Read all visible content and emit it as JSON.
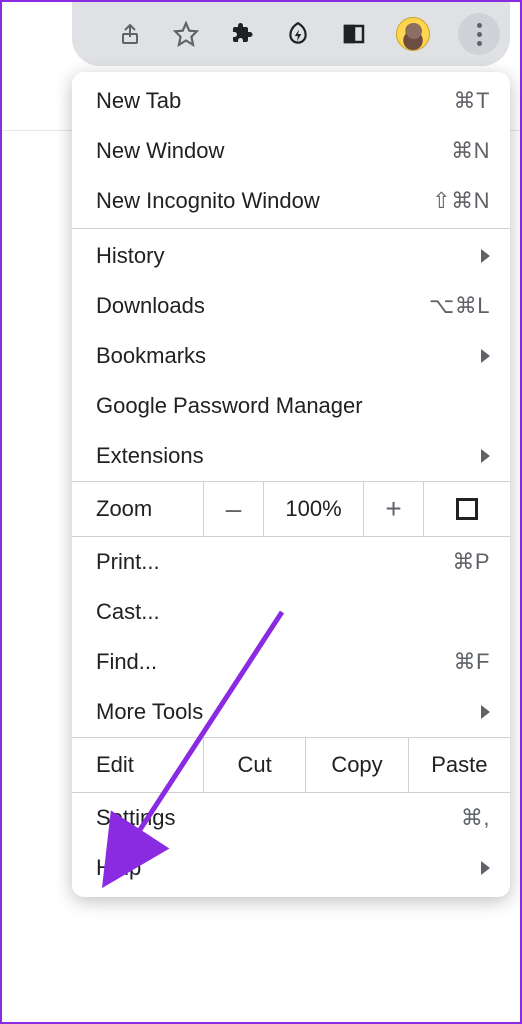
{
  "toolbar": {
    "icons": [
      "share-icon",
      "star-icon",
      "extensions-icon",
      "energy-icon",
      "sidepanel-icon",
      "avatar",
      "more-vert-icon"
    ]
  },
  "menu": {
    "new_tab": {
      "label": "New Tab",
      "shortcut": "⌘T"
    },
    "new_window": {
      "label": "New Window",
      "shortcut": "⌘N"
    },
    "new_incognito": {
      "label": "New Incognito Window",
      "shortcut": "⇧⌘N"
    },
    "history": {
      "label": "History"
    },
    "downloads": {
      "label": "Downloads",
      "shortcut": "⌥⌘L"
    },
    "bookmarks": {
      "label": "Bookmarks"
    },
    "password_manager": {
      "label": "Google Password Manager"
    },
    "extensions": {
      "label": "Extensions"
    },
    "zoom": {
      "label": "Zoom",
      "minus": "–",
      "pct": "100%",
      "plus": "+"
    },
    "print": {
      "label": "Print...",
      "shortcut": "⌘P"
    },
    "cast": {
      "label": "Cast..."
    },
    "find": {
      "label": "Find...",
      "shortcut": "⌘F"
    },
    "more_tools": {
      "label": "More Tools"
    },
    "edit": {
      "label": "Edit",
      "cut": "Cut",
      "copy": "Copy",
      "paste": "Paste"
    },
    "settings": {
      "label": "Settings",
      "shortcut": "⌘,"
    },
    "help": {
      "label": "Help"
    }
  }
}
